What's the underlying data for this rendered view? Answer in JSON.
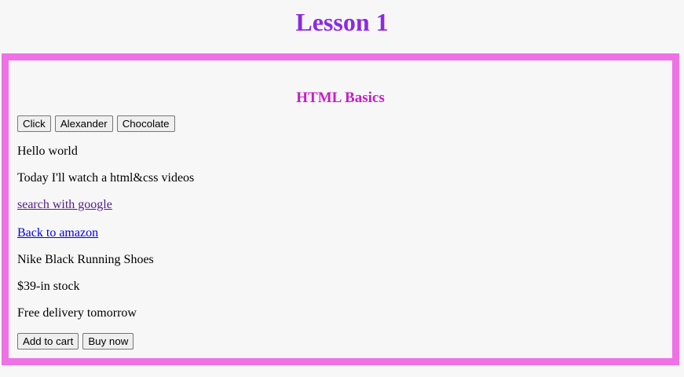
{
  "page": {
    "title": "Lesson 1"
  },
  "lesson": {
    "heading": "HTML Basics",
    "top_buttons": [
      "Click",
      "Alexander",
      "Chocolate"
    ],
    "hello": "Hello world",
    "today": "Today I'll watch a html&css videos",
    "google_link": "search with google",
    "amazon_link": "Back to amazon",
    "product_name": "Nike Black Running Shoes",
    "price_stock": "$39-in stock",
    "delivery": "Free delivery tomorrow",
    "add_to_cart": "Add to cart",
    "buy_now": "Buy now"
  },
  "colors": {
    "title": "#8a2be2",
    "heading": "#c71dc7",
    "border": "#ee72e6",
    "background": "#f7f7f7"
  }
}
